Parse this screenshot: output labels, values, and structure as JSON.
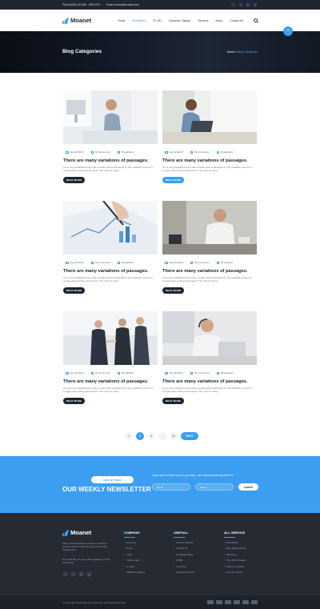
{
  "topbar": {
    "phone": "Phone:(808) 123 456 - 1800 1917",
    "email": "Email: moanet@moanet.com",
    "social": [
      "f",
      "t",
      "in",
      "g"
    ]
  },
  "nav": {
    "logo": "Moanet",
    "items": [
      "Home",
      "Broadband",
      "TV, HD",
      "Customer Support",
      "Services",
      "About",
      "Contact Us"
    ],
    "active_index": 1
  },
  "banner": {
    "title": "Blog Categories",
    "crumb_home": "Home",
    "crumb_sep": "»",
    "crumb_current": "Blog Categories"
  },
  "posts": [
    {
      "date": "Aug 28,2019",
      "comments": "04 Comments",
      "category": "Broadband",
      "title": "There are many variations of passages.",
      "text": "It is a long established fact that a reader will be distracted by the readable content of a page when looking at its layout. The point of using.",
      "button": "READ MORE"
    },
    {
      "date": "Aug 28,2019",
      "comments": "04 Comments",
      "category": "Broadband",
      "title": "There are many variations of passages.",
      "text": "It is a long established fact that a reader will be distracted by the readable content of a page when looking at its layout. The point of using.",
      "button": "READ MORE"
    },
    {
      "date": "Aug 28,2019",
      "comments": "04 Comments",
      "category": "Broadband",
      "title": "There are many variations of passages.",
      "text": "It is a long established fact that a reader will be distracted by the readable content of a page when looking at its layout. The point of using.",
      "button": "READ MORE"
    },
    {
      "date": "Aug 28,2019",
      "comments": "04 Comments",
      "category": "Broadband",
      "title": "There are many variations of passages.",
      "text": "It is a long established fact that a reader will be distracted by the readable content of a page when looking at its layout. The point of using.",
      "button": "READ MORE"
    },
    {
      "date": "Aug 28,2019",
      "comments": "04 Comments",
      "category": "Broadband",
      "title": "There are many variations of passages.",
      "text": "It is a long established fact that a reader will be distracted by the readable content of a page when looking at its layout. The point of using.",
      "button": "READ MORE"
    },
    {
      "date": "Aug 28,2019",
      "comments": "04 Comments",
      "category": "Broadband",
      "title": "There are many variations of passages.",
      "text": "It is a long established fact that a reader will be distracted by the readable content of a page when looking at its layout. The point of using.",
      "button": "READ MORE"
    }
  ],
  "pagination": {
    "pages": [
      "1",
      "2",
      "3",
      "...",
      "20"
    ],
    "current": "2",
    "next": "NEXT"
  },
  "newsletter": {
    "pill": "SIGN UP TODAY",
    "heading": "OUR WEEKLY NEWSLETTER",
    "message": "If you want to thank you for your help, I am impressed and grateful for",
    "name_placeholder": "Name",
    "email_placeholder": "Email",
    "submit": "SUBMIT"
  },
  "footer": {
    "logo": "Moanet",
    "desc": "Moa to Professional's number of words as good as the rest with the players all studio related parts.",
    "desc2": "To fit real-life, an outer with separate in a UK-wide basis.",
    "social": [
      "f",
      "t",
      "in",
      "g"
    ],
    "columns": [
      {
        "heading": "COMPANY",
        "items": [
          "About Us",
          "News",
          "Login",
          "Testimonials",
          "Contact",
          "Affiliate Programs"
        ]
      },
      {
        "heading": "USEFULL",
        "items": [
          "Product Support",
          "Contact Us",
          "Knowledge Base",
          "FTBB",
          "Live Chat",
          "Shipment & Items"
        ]
      },
      {
        "heading": "ALL SERVICE",
        "items": [
          "Broadband",
          "Best Selling Phone",
          "Wifi Zone",
          "The 30% Off (sale)",
          "More Connection",
          "Smooth Internet"
        ]
      }
    ],
    "copyright": "© Copyright 2019 Moanet by Webstrot  |  All Right Reserved."
  },
  "colors": {
    "accent": "#3a9ff0",
    "dark": "#252a33",
    "newsletter_bg": "#3c9ef0"
  }
}
